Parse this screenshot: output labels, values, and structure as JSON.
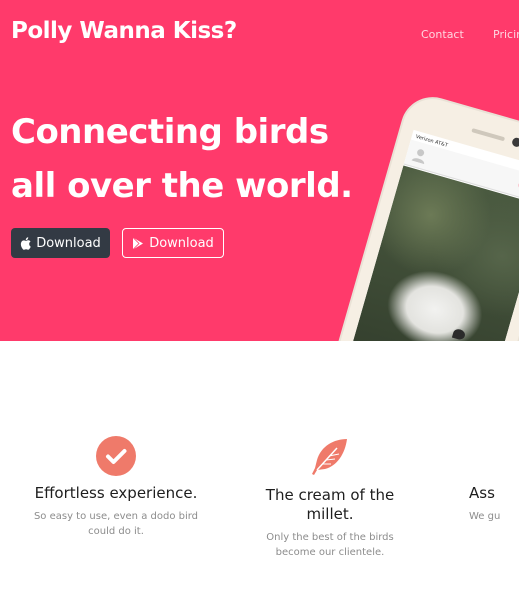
{
  "header": {
    "brand": "Polly Wanna Kiss?",
    "nav": [
      "Contact",
      "Pricin"
    ]
  },
  "hero": {
    "headline_line1": "Connecting birds",
    "headline_line2": "all over the world.",
    "buttons": [
      {
        "label": "Download",
        "icon": "apple-icon"
      },
      {
        "label": "Download",
        "icon": "google-play-icon"
      }
    ],
    "phone": {
      "status": "Verizon AT&T"
    }
  },
  "features": [
    {
      "icon": "checkmark-circle-icon",
      "title": "Effortless experience.",
      "desc_line1": "So easy to use, even a dodo bird",
      "desc_line2": "could do it."
    },
    {
      "icon": "feather-icon",
      "title_line1": "The cream of the",
      "title_line2": "millet.",
      "desc_line1": "Only the best of the birds",
      "desc_line2": "become our clientele."
    },
    {
      "title": "Ass",
      "desc": "We gu"
    }
  ],
  "colors": {
    "hero_background": "#ff3a6b",
    "apple_button": "#333a44",
    "icon_accent": "#ef7a6a"
  }
}
